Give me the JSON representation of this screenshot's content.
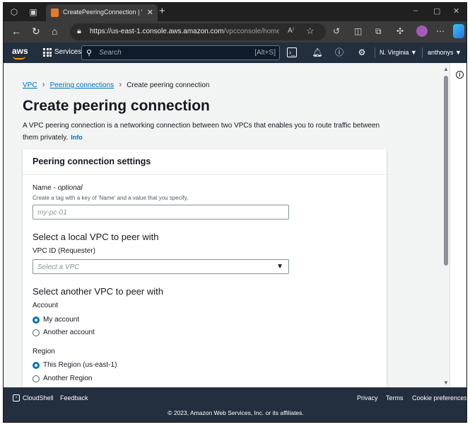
{
  "browser": {
    "tab_title": "CreatePeeringConnection | VPC C",
    "url_domain": "https://us-east-1.console.aws.amazon.com",
    "url_path": "/vpcconsole/home?regi...",
    "reader_label": "A⁾",
    "icons": [
      "workspaces-icon",
      "tab-actions-icon",
      "back-icon",
      "refresh-icon",
      "home-icon",
      "lock-icon",
      "read-aloud-icon",
      "favorite-star-icon",
      "split-screen-icon",
      "collections-icon",
      "extensions-icon",
      "profile-avatar",
      "copilot-icon"
    ]
  },
  "aws_header": {
    "logo": "aws",
    "services_label": "Services",
    "search_placeholder": "Search",
    "search_shortcut": "[Alt+S]",
    "region": "N. Virginia ▼",
    "user": "anthonys ▼",
    "accent_color": "#ff9900",
    "bar_color": "#232f3e"
  },
  "breadcrumb": {
    "items": [
      "VPC",
      "Peering connections",
      "Create peering connection"
    ]
  },
  "page": {
    "title": "Create peering connection",
    "description": "A VPC peering connection is a networking connection between two VPCs that enables you to route traffic between them privately.",
    "info_link": "Info"
  },
  "panel": {
    "title": "Peering connection settings",
    "name_label": "Name - ",
    "name_optional": "optional",
    "name_help": "Create a tag with a key of 'Name' and a value that you specify.",
    "name_placeholder": "my-pc-01",
    "local_heading": "Select a local VPC to peer with",
    "vpc_id_label": "VPC ID (Requester)",
    "vpc_placeholder": "Select a VPC",
    "another_heading": "Select another VPC to peer with",
    "account_label": "Account",
    "account_options": [
      "My account",
      "Another account"
    ],
    "account_selected": "My account",
    "region_label": "Region",
    "region_options": [
      "This Region (us-east-1)",
      "Another Region"
    ],
    "region_selected": "This Region (us-east-1)"
  },
  "footer": {
    "cloudshell": "CloudShell",
    "feedback": "Feedback",
    "privacy": "Privacy",
    "terms": "Terms",
    "cookie": "Cookie preferences",
    "copyright": "© 2023, Amazon Web Services, Inc. or its affiliates."
  }
}
